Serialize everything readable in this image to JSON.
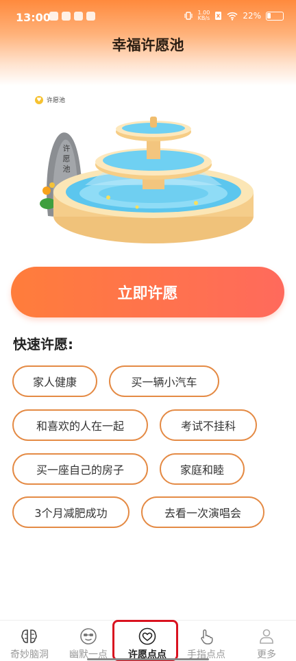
{
  "status_bar": {
    "time": "13:00",
    "speed_value": "1.00",
    "speed_unit": "KB/s",
    "battery": "22%"
  },
  "header": {
    "title": "幸福许愿池"
  },
  "scene": {
    "tag": "许愿池",
    "stone_text": [
      "许",
      "愿",
      "池"
    ]
  },
  "wish_button": {
    "label": "立即许愿"
  },
  "quick_wishes": {
    "title": "快速许愿:",
    "items": [
      "家人健康",
      "买一辆小汽车",
      "和喜欢的人在一起",
      "考试不挂科",
      "买一座自己的房子",
      "家庭和睦",
      "3个月减肥成功",
      "去看一次演唱会"
    ]
  },
  "tabbar": {
    "items": [
      {
        "label": "奇妙脑洞",
        "icon": "brain-icon"
      },
      {
        "label": "幽默一点",
        "icon": "smile-glasses-icon"
      },
      {
        "label": "许愿点点",
        "icon": "heart-icon",
        "active": true
      },
      {
        "label": "手指点点",
        "icon": "finger-icon"
      },
      {
        "label": "更多",
        "icon": "person-icon"
      }
    ]
  }
}
